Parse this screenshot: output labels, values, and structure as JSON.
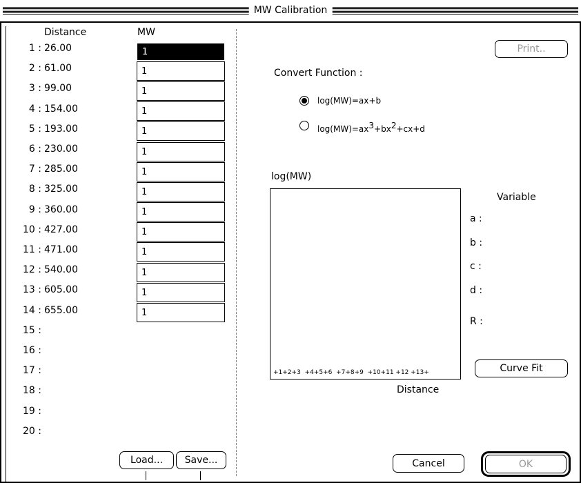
{
  "window": {
    "title": "MW Calibration"
  },
  "list": {
    "header_distance": "Distance",
    "header_mw": "MW",
    "rows": [
      {
        "label": "1 :",
        "distance": "26.00",
        "mw": "1"
      },
      {
        "label": "2 :",
        "distance": "61.00",
        "mw": "1"
      },
      {
        "label": "3 :",
        "distance": "99.00",
        "mw": "1"
      },
      {
        "label": "4 :",
        "distance": "154.00",
        "mw": "1"
      },
      {
        "label": "5 :",
        "distance": "193.00",
        "mw": "1"
      },
      {
        "label": "6 :",
        "distance": "230.00",
        "mw": "1"
      },
      {
        "label": "7 :",
        "distance": "285.00",
        "mw": "1"
      },
      {
        "label": "8 :",
        "distance": "325.00",
        "mw": "1"
      },
      {
        "label": "9 :",
        "distance": "360.00",
        "mw": "1"
      },
      {
        "label": "10 :",
        "distance": "427.00",
        "mw": "1"
      },
      {
        "label": "11 :",
        "distance": "471.00",
        "mw": "1"
      },
      {
        "label": "12 :",
        "distance": "540.00",
        "mw": "1"
      },
      {
        "label": "13 :",
        "distance": "605.00",
        "mw": "1"
      },
      {
        "label": "14 :",
        "distance": "655.00",
        "mw": "1"
      },
      {
        "label": "15 :",
        "distance": "",
        "mw": ""
      },
      {
        "label": "16 :",
        "distance": "",
        "mw": ""
      },
      {
        "label": "17 :",
        "distance": "",
        "mw": ""
      },
      {
        "label": "18 :",
        "distance": "",
        "mw": ""
      },
      {
        "label": "19 :",
        "distance": "",
        "mw": ""
      },
      {
        "label": "20 :",
        "distance": "",
        "mw": ""
      }
    ]
  },
  "buttons": {
    "load": "Load...",
    "save": "Save...",
    "print": "Print..",
    "curve_fit": "Curve Fit",
    "cancel": "Cancel",
    "ok": "OK"
  },
  "convert": {
    "label": "Convert Function :",
    "options": [
      {
        "id": "linear",
        "selected": true
      },
      {
        "id": "cubic",
        "selected": false
      }
    ]
  },
  "plot": {
    "y_label": "log(MW)",
    "x_label": "Distance",
    "ticks": "+1+2+3  +4+5+6  +7+8+9  +10+11 +12 +13+"
  },
  "variables": {
    "heading": "Variable",
    "items": [
      "a :",
      "b :",
      "c :",
      "d :",
      "R :"
    ]
  },
  "colors": {
    "active_cell_bg": "#000000",
    "disabled_text": "#999999"
  },
  "icons": {
    "radio_selected": "radio-selected-icon",
    "radio_unselected": "radio-unselected-icon"
  }
}
